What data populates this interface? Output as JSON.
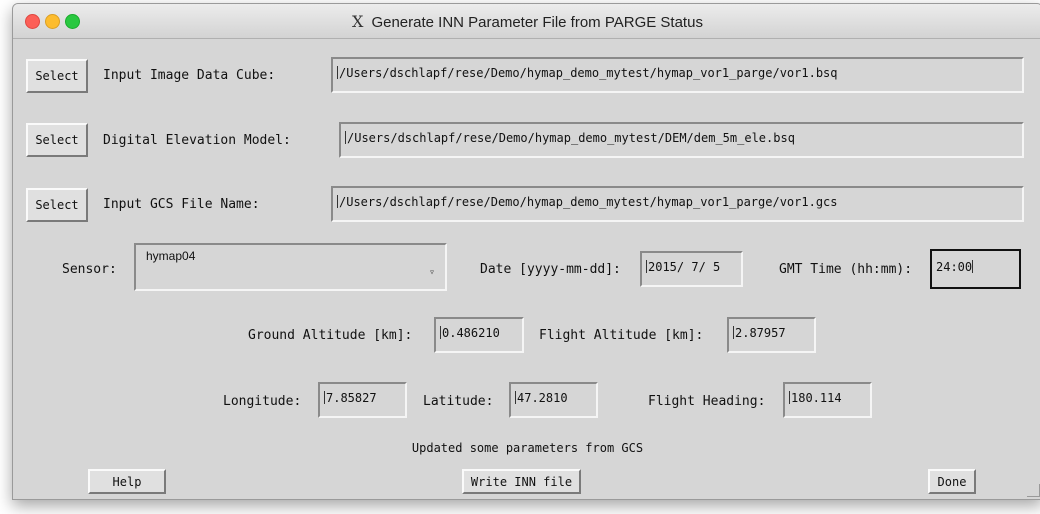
{
  "window": {
    "title": "Generate INN Parameter File from PARGE Status",
    "x_icon": "X"
  },
  "rows": [
    {
      "button": "Select",
      "label": "Input Image Data Cube:",
      "value": "/Users/dschlapf/rese/Demo/hymap_demo_mytest/hymap_vor1_parge/vor1.bsq"
    },
    {
      "button": "Select",
      "label": "Digital Elevation Model:",
      "value": "/Users/dschlapf/rese/Demo/hymap_demo_mytest/DEM/dem_5m_ele.bsq"
    },
    {
      "button": "Select",
      "label": "Input GCS File Name:",
      "value": "/Users/dschlapf/rese/Demo/hymap_demo_mytest/hymap_vor1_parge/vor1.gcs"
    }
  ],
  "sensor": {
    "label": "Sensor:",
    "value": "hymap04"
  },
  "date": {
    "label": "Date [yyyy-mm-dd]:",
    "value": "2015/ 7/ 5"
  },
  "gmt": {
    "label": "GMT Time (hh:mm):",
    "value": "24:00"
  },
  "ground_alt": {
    "label": "Ground Altitude [km]:",
    "value": "0.486210"
  },
  "flight_alt": {
    "label": "Flight Altitude [km]:",
    "value": "2.87957"
  },
  "longitude": {
    "label": "Longitude:",
    "value": "7.85827"
  },
  "latitude": {
    "label": "Latitude:",
    "value": "47.2810"
  },
  "heading": {
    "label": "Flight Heading:",
    "value": "180.114"
  },
  "status_text": "Updated some parameters from GCS",
  "footer": {
    "help": "Help",
    "write": "Write INN file",
    "done": "Done"
  }
}
